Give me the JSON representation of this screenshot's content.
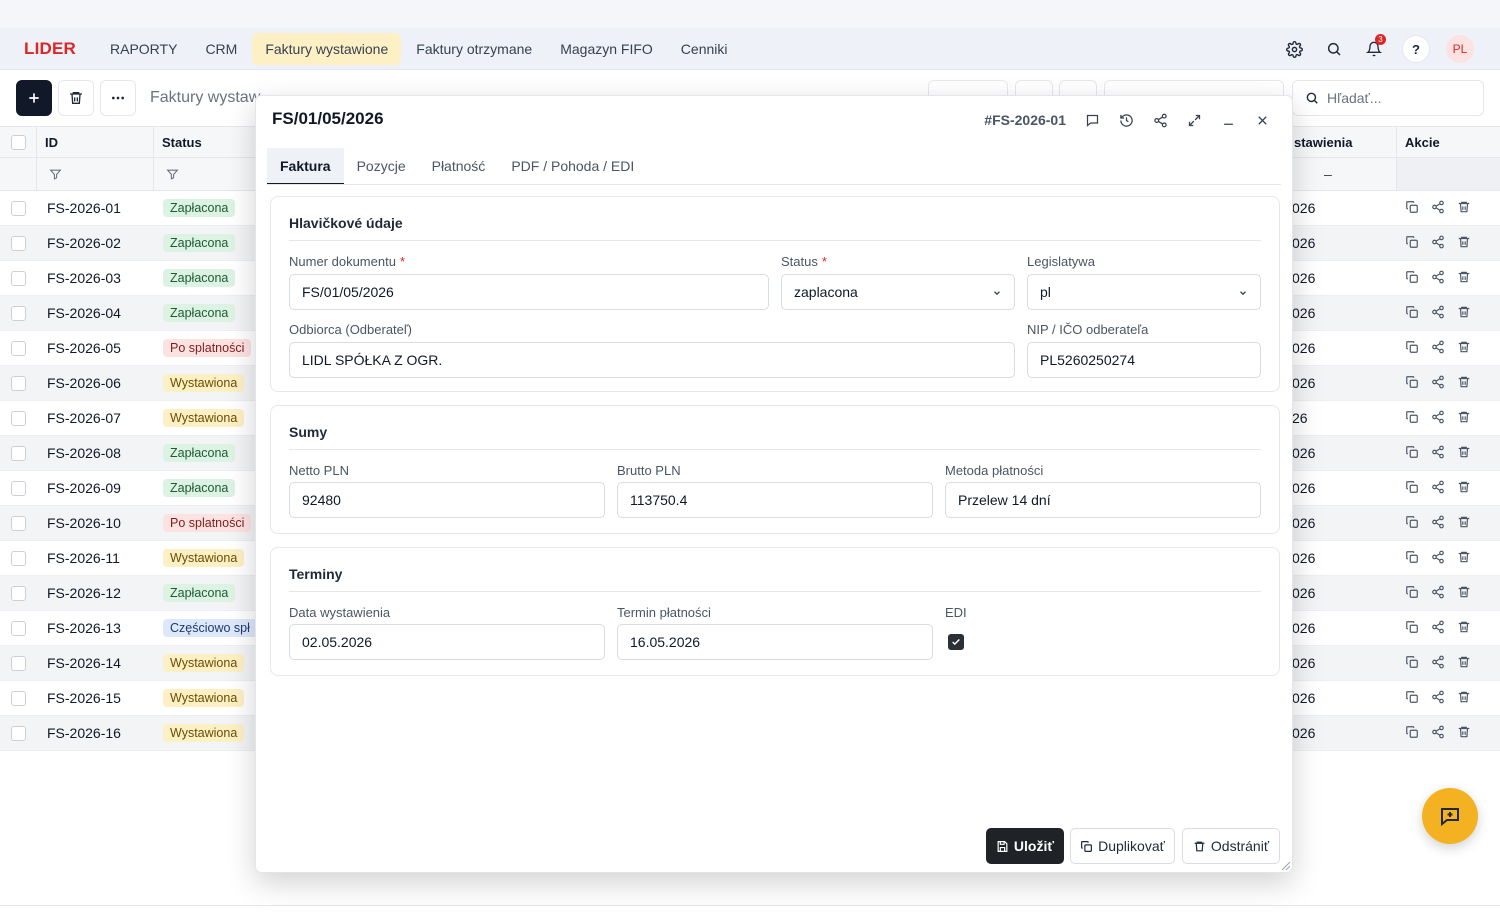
{
  "app": {
    "logo": "LIDER",
    "nav": [
      "RAPORTY",
      "CRM",
      "Faktury wystawione",
      "Faktury otrzymane",
      "Magazyn FIFO",
      "Cenniki"
    ],
    "active_nav": "Faktury wystawione",
    "notifications_count": "3",
    "help_label": "?",
    "avatar_initials": "PL"
  },
  "toolbar": {
    "breadcrumb": "Faktury wystaw",
    "search_placeholder": "Hľadať..."
  },
  "table": {
    "headers": {
      "id": "ID",
      "status": "Status",
      "date": "stawienia",
      "actions": "Akcie"
    },
    "date_filter_placeholder": "–",
    "rows": [
      {
        "id": "FS-2026-01",
        "status": "Zapłacona",
        "kind": "paid",
        "date": "026"
      },
      {
        "id": "FS-2026-02",
        "status": "Zapłacona",
        "kind": "paid",
        "date": "026"
      },
      {
        "id": "FS-2026-03",
        "status": "Zapłacona",
        "kind": "paid",
        "date": "026"
      },
      {
        "id": "FS-2026-04",
        "status": "Zapłacona",
        "kind": "paid",
        "date": "026"
      },
      {
        "id": "FS-2026-05",
        "status": "Po splatności",
        "kind": "overdue",
        "date": "026"
      },
      {
        "id": "FS-2026-06",
        "status": "Wystawiona",
        "kind": "issued",
        "date": "026"
      },
      {
        "id": "FS-2026-07",
        "status": "Wystawiona",
        "kind": "issued",
        "date": "26"
      },
      {
        "id": "FS-2026-08",
        "status": "Zapłacona",
        "kind": "paid",
        "date": "026"
      },
      {
        "id": "FS-2026-09",
        "status": "Zapłacona",
        "kind": "paid",
        "date": "026"
      },
      {
        "id": "FS-2026-10",
        "status": "Po splatności",
        "kind": "overdue",
        "date": "026"
      },
      {
        "id": "FS-2026-11",
        "status": "Wystawiona",
        "kind": "issued",
        "date": "026"
      },
      {
        "id": "FS-2026-12",
        "status": "Zapłacona",
        "kind": "paid",
        "date": "026"
      },
      {
        "id": "FS-2026-13",
        "status": "Częściowo spł",
        "kind": "partial",
        "date": "026"
      },
      {
        "id": "FS-2026-14",
        "status": "Wystawiona",
        "kind": "issued",
        "date": "026"
      },
      {
        "id": "FS-2026-15",
        "status": "Wystawiona",
        "kind": "issued",
        "date": "026"
      },
      {
        "id": "FS-2026-16",
        "status": "Wystawiona",
        "kind": "issued",
        "date": "026"
      }
    ]
  },
  "status_colors": {
    "paid": {
      "bg": "#dcf3e4",
      "fg": "#1f5a35"
    },
    "overdue": {
      "bg": "#fde2e2",
      "fg": "#7f1d1d"
    },
    "issued": {
      "bg": "#fdf0c4",
      "fg": "#6b4e00"
    },
    "partial": {
      "bg": "#dde8fb",
      "fg": "#1e3a6e"
    }
  },
  "modal": {
    "title": "FS/01/05/2026",
    "record_id": "#FS-2026-01",
    "tabs": [
      "Faktura",
      "Pozycje",
      "Płatność",
      "PDF / Pohoda / EDI"
    ],
    "active_tab": "Faktura",
    "sections": {
      "header": {
        "title": "Hlavičkové údaje",
        "doc_number_label": "Numer dokumentu",
        "doc_number_value": "FS/01/05/2026",
        "status_label": "Status",
        "status_value": "zaplacona",
        "legislation_label": "Legislatywa",
        "legislation_value": "pl",
        "customer_label": "Odbiorca (Odberateľ)",
        "customer_value": "LIDL SPÓŁKA Z OGR.",
        "tax_id_label": "NIP / IČO odberateľa",
        "tax_id_value": "PL5260250274",
        "required_mark": "*"
      },
      "sums": {
        "title": "Sumy",
        "net_label": "Netto PLN",
        "net_value": "92480",
        "gross_label": "Brutto PLN",
        "gross_value": "113750.4",
        "payment_method_label": "Metoda płatności",
        "payment_method_value": "Przelew 14 dní"
      },
      "terms": {
        "title": "Terminy",
        "issue_date_label": "Data wystawienia",
        "issue_date_value": "02.05.2026",
        "due_date_label": "Termin płatności",
        "due_date_value": "16.05.2026",
        "edi_label": "EDI",
        "edi_checked": true
      }
    },
    "buttons": {
      "save": "Uložiť",
      "duplicate": "Duplikovať",
      "delete": "Odstrániť"
    }
  }
}
